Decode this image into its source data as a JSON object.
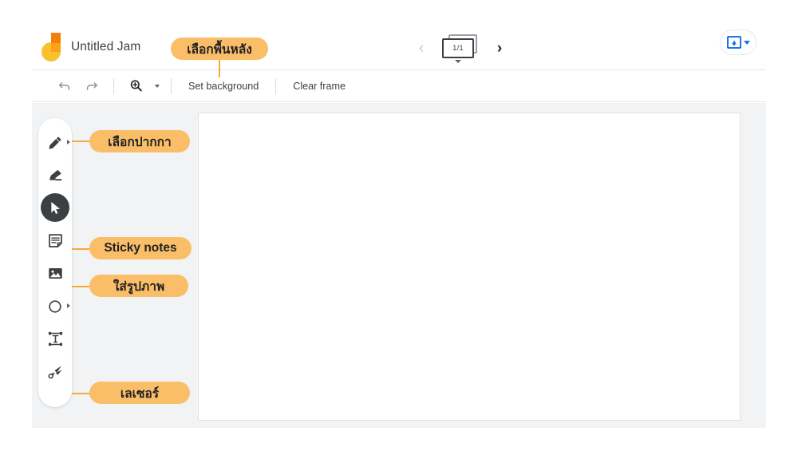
{
  "app": {
    "name": "Jamboard",
    "logo_icon": "jamboard-logo",
    "background": "#ffffff",
    "canvas_background": "#f1f3f4",
    "accent_orange": "#FBBE68",
    "accent_blue": "#1a73e8"
  },
  "header": {
    "title": "Untitled Jam",
    "frame_nav": {
      "prev_label": "‹",
      "prev_icon": "chevron-left-icon",
      "prev_enabled": false,
      "next_label": "›",
      "next_icon": "chevron-right-icon",
      "next_enabled": true,
      "counter": "1/1",
      "frame_icon": "frame-stack-icon",
      "expand_icon": "caret-down-icon"
    },
    "present": {
      "icon": "present-screen-icon",
      "caret_icon": "caret-down-icon"
    }
  },
  "toolbar": {
    "undo_icon": "undo-icon",
    "redo_icon": "redo-icon",
    "zoom_icon": "zoom-in-icon",
    "zoom_caret_icon": "caret-down-icon",
    "set_background_label": "Set background",
    "clear_frame_label": "Clear frame"
  },
  "tools": [
    {
      "name": "pen",
      "icon": "pen-icon",
      "active": false,
      "has_submenu": true
    },
    {
      "name": "eraser",
      "icon": "eraser-icon",
      "active": false,
      "has_submenu": false
    },
    {
      "name": "select",
      "icon": "cursor-icon",
      "active": true,
      "has_submenu": false
    },
    {
      "name": "sticky-note",
      "icon": "sticky-note-icon",
      "active": false,
      "has_submenu": false
    },
    {
      "name": "image",
      "icon": "image-icon",
      "active": false,
      "has_submenu": false
    },
    {
      "name": "shape",
      "icon": "circle-icon",
      "active": false,
      "has_submenu": true
    },
    {
      "name": "text-box",
      "icon": "text-box-icon",
      "active": false,
      "has_submenu": false
    },
    {
      "name": "laser",
      "icon": "laser-icon",
      "active": false,
      "has_submenu": false
    }
  ],
  "annotations": [
    {
      "id": "background",
      "label": "เลือกพื้นหลัง",
      "script": "thai"
    },
    {
      "id": "pen",
      "label": "เลือกปากกา",
      "script": "thai"
    },
    {
      "id": "sticky-notes",
      "label": "Sticky notes",
      "script": "latin"
    },
    {
      "id": "image",
      "label": "ใส่รูปภาพ",
      "script": "thai"
    },
    {
      "id": "laser",
      "label": "เลเซอร์",
      "script": "thai"
    }
  ]
}
